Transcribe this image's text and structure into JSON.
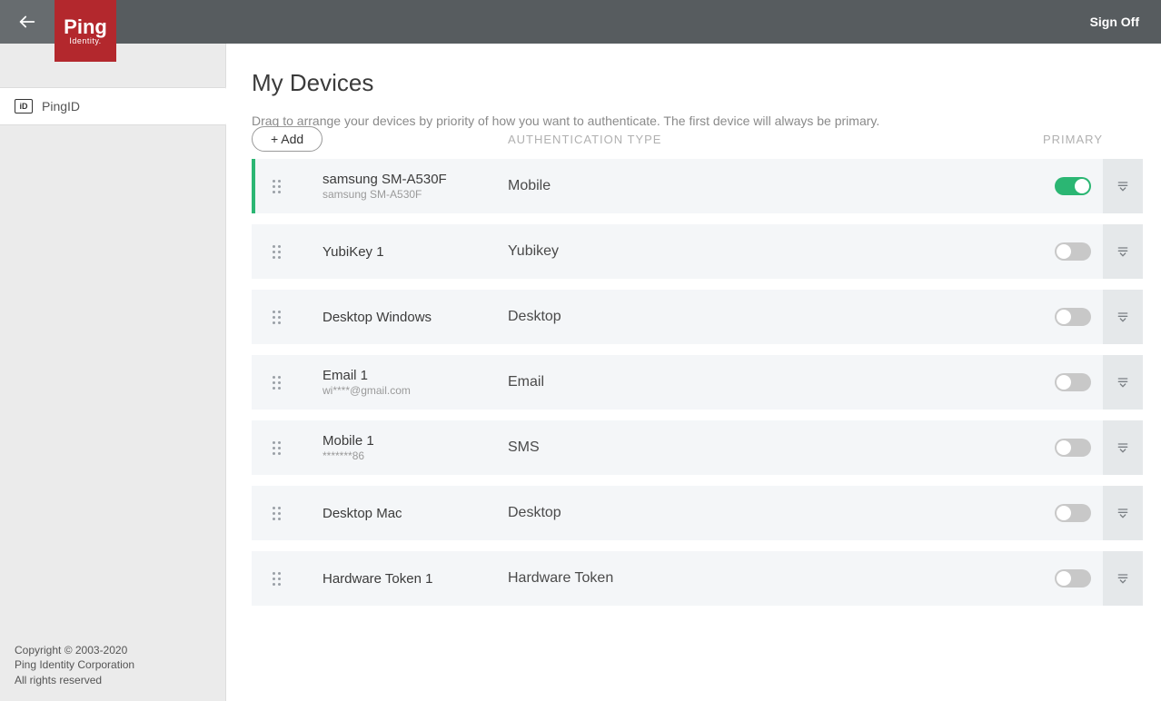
{
  "header": {
    "sign_off": "Sign Off",
    "logo_main": "Ping",
    "logo_sub": "Identity."
  },
  "sidebar": {
    "items": [
      {
        "icon_text": "iD",
        "label": "PingID"
      }
    ],
    "footer_line1": "Copyright © 2003-2020",
    "footer_line2": "Ping Identity Corporation",
    "footer_line3": "All rights reserved"
  },
  "main": {
    "title": "My Devices",
    "description": "Drag to arrange your devices by priority of how you want to authenticate. The first device will always be primary.",
    "add_label": "+ Add",
    "columns": {
      "auth_type": "AUTHENTICATION TYPE",
      "primary": "PRIMARY"
    },
    "devices": [
      {
        "name": "samsung SM-A530F",
        "sub": "samsung SM-A530F",
        "auth": "Mobile",
        "primary": true
      },
      {
        "name": "YubiKey 1",
        "sub": "",
        "auth": "Yubikey",
        "primary": false
      },
      {
        "name": "Desktop Windows",
        "sub": "",
        "auth": "Desktop",
        "primary": false
      },
      {
        "name": "Email 1",
        "sub": "wi****@gmail.com",
        "auth": "Email",
        "primary": false
      },
      {
        "name": "Mobile 1",
        "sub": "*******86",
        "auth": "SMS",
        "primary": false
      },
      {
        "name": "Desktop Mac",
        "sub": "",
        "auth": "Desktop",
        "primary": false
      },
      {
        "name": "Hardware Token 1",
        "sub": "",
        "auth": "Hardware Token",
        "primary": false
      }
    ]
  }
}
